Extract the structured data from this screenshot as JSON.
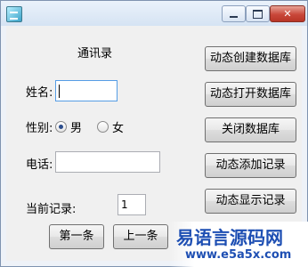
{
  "window": {
    "minimize_glyph": "minimize-icon",
    "maximize_glyph": "maximize-icon",
    "close_glyph": "✕"
  },
  "form": {
    "title": "通讯录",
    "name_label": "姓名:",
    "name_value": "",
    "gender_label": "性别:",
    "gender_options": [
      {
        "label": "男",
        "selected": true
      },
      {
        "label": "女",
        "selected": false
      }
    ],
    "phone_label": "电话:",
    "phone_value": "",
    "current_record_label": "当前记录:",
    "current_record_value": "1"
  },
  "buttons": {
    "create_db": "动态创建数据库",
    "open_db": "动态打开数据库",
    "close_db": "关闭数据库",
    "add_record": "动态添加记录",
    "show_record": "动态显示记录",
    "first": "第一条",
    "prev": "上一条"
  },
  "watermark": {
    "title": "易语言源码网",
    "url": "www.e5a5x.com"
  }
}
